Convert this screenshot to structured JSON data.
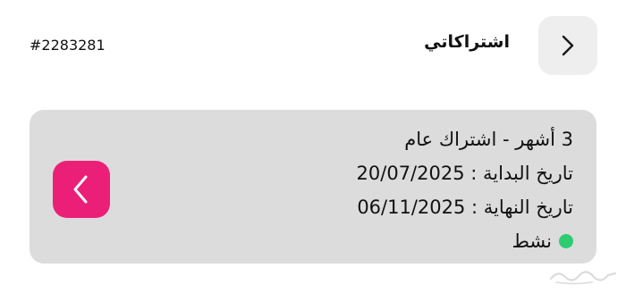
{
  "header": {
    "title": "اشتراكاتي",
    "order_id": "#2283281",
    "back_icon": "chevron-right-icon"
  },
  "subscription": {
    "plan": "3 أشهر - اشتراك عام",
    "start": "تاريخ البداية : 20/07/2025",
    "end": "تاريخ النهاية : 06/11/2025",
    "status": "نشط",
    "open_icon": "chevron-left-icon"
  },
  "colors": {
    "accent": "#ec1f78",
    "status_active": "#2ecc71",
    "card_bg": "#dcdcdd"
  },
  "watermark_logo": "haraj-logo"
}
